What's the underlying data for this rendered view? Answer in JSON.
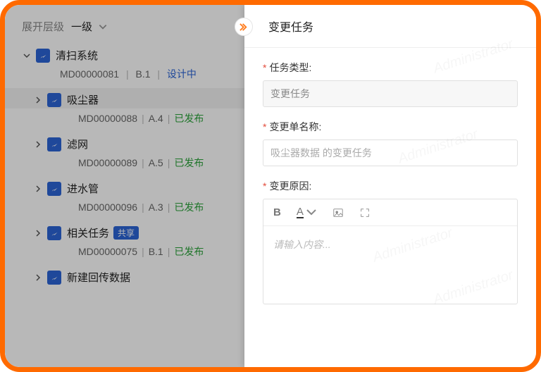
{
  "header": {
    "expand_label": "展开层级",
    "level_label": "一级"
  },
  "tree": {
    "root": {
      "title": "清扫系统",
      "code": "MD00000081",
      "ver": "B.1",
      "status": "设计中"
    },
    "children": [
      {
        "title": "吸尘器",
        "code": "MD00000088",
        "ver": "A.4",
        "status": "已发布",
        "selected": true
      },
      {
        "title": "滤网",
        "code": "MD00000089",
        "ver": "A.5",
        "status": "已发布"
      },
      {
        "title": "进水管",
        "code": "MD00000096",
        "ver": "A.3",
        "status": "已发布"
      },
      {
        "title": "相关任务",
        "code": "MD00000075",
        "ver": "B.1",
        "status": "已发布",
        "shared": "共享"
      },
      {
        "title": "新建回传数据"
      }
    ]
  },
  "panel": {
    "title": "变更任务",
    "fields": {
      "type_label": "任务类型:",
      "type_value": "变更任务",
      "name_label": "变更单名称:",
      "name_placeholder": "吸尘器数据 的变更任务",
      "reason_label": "变更原因:",
      "editor_placeholder": "请输入内容..."
    }
  },
  "watermark": "Administrator"
}
